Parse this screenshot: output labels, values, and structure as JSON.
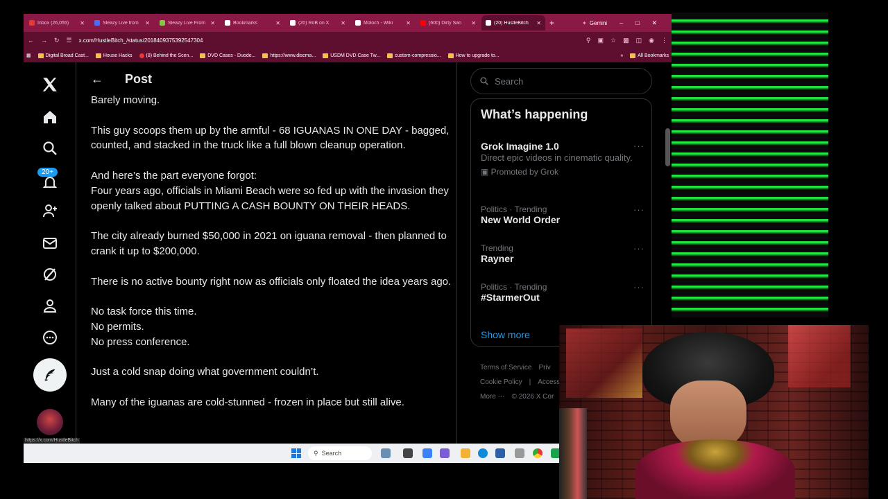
{
  "browser": {
    "tabs": [
      {
        "title": "Inbox (26,055)",
        "icon": "gmail-icon",
        "color": "#e53935",
        "active": false
      },
      {
        "title": "Sleazy Live from",
        "icon": "b-icon",
        "color": "#4a6cf7",
        "active": false
      },
      {
        "title": "Sleazy Live From",
        "icon": "rumble-icon",
        "color": "#85c742",
        "active": false
      },
      {
        "title": "Bookmarks",
        "icon": "star-icon",
        "color": "#ffffff",
        "active": false
      },
      {
        "title": "(20) RoB on X",
        "icon": "x-icon",
        "color": "#ffffff",
        "active": false
      },
      {
        "title": "Moloch - Wiki",
        "icon": "wikipedia-icon",
        "color": "#ffffff",
        "active": false
      },
      {
        "title": "(600) Dirty San",
        "icon": "youtube-icon",
        "color": "#ff0000",
        "active": false
      },
      {
        "title": "(20) HustleBitch",
        "icon": "x-icon",
        "color": "#ffffff",
        "active": true
      }
    ],
    "gemini_label": "Gemini",
    "url": "x.com/HustleBitch_/status/2018409375392547304",
    "bookmarks": [
      "Digital Broad Cast...",
      "House Hacks",
      "(8) Behind the Scen...",
      "DVD Cases - Duode...",
      "https://www.discma...",
      "USDM DVD Case Tw...",
      "custom-compressio...",
      "How to upgrade to..."
    ],
    "all_bookmarks": "All Bookmarks",
    "status_link": "https://x.com/HustleBitch"
  },
  "nav": {
    "notif_badge": "20+"
  },
  "post": {
    "header_title": "Post",
    "paragraphs": [
      [
        "Barely moving."
      ],
      [
        "This guy scoops them up by the armful - 68 IGUANAS IN ONE DAY - bagged, counted, and stacked in the truck like a full blown cleanup operation."
      ],
      [
        "And here’s the part everyone forgot:",
        "Four years ago, officials in Miami Beach were so fed up with the invasion they openly talked about PUTTING A CASH BOUNTY ON THEIR HEADS."
      ],
      [
        "The city already burned $50,000 in 2021 on iguana removal - then planned to crank it up to $200,000."
      ],
      [
        "There is no active bounty right now as officials only floated the idea years ago."
      ],
      [
        "No task force this time.",
        "No permits.",
        "No press conference."
      ],
      [
        "Just a cold snap doing what government couldn’t."
      ],
      [
        "Many of the iguanas are cold-stunned - frozen in place but still alive."
      ]
    ]
  },
  "sidebar": {
    "search_placeholder": "Search",
    "trends_title": "What’s happening",
    "trends": [
      {
        "meta": "",
        "name": "Grok Imagine 1.0",
        "desc": "Direct epic videos in cinematic quality.",
        "promo": "Promoted by Grok"
      },
      {
        "meta": "Politics · Trending",
        "name": "New World Order",
        "desc": "",
        "promo": ""
      },
      {
        "meta": "Trending",
        "name": "Rayner",
        "desc": "",
        "promo": ""
      },
      {
        "meta": "Politics · Trending",
        "name": "#StarmerOut",
        "desc": "",
        "promo": ""
      }
    ],
    "show_more": "Show more",
    "footer": [
      "Terms of Service",
      "Priv",
      "Cookie Policy",
      "|",
      "Access",
      "More ···",
      "© 2026 X Cor"
    ]
  },
  "taskbar": {
    "search_label": "Search"
  },
  "colors": {
    "tabbar": "#8a1a45",
    "toolbar": "#5e0f2f",
    "accent": "#1d9bf0",
    "stripe_green": "#18e23a"
  }
}
